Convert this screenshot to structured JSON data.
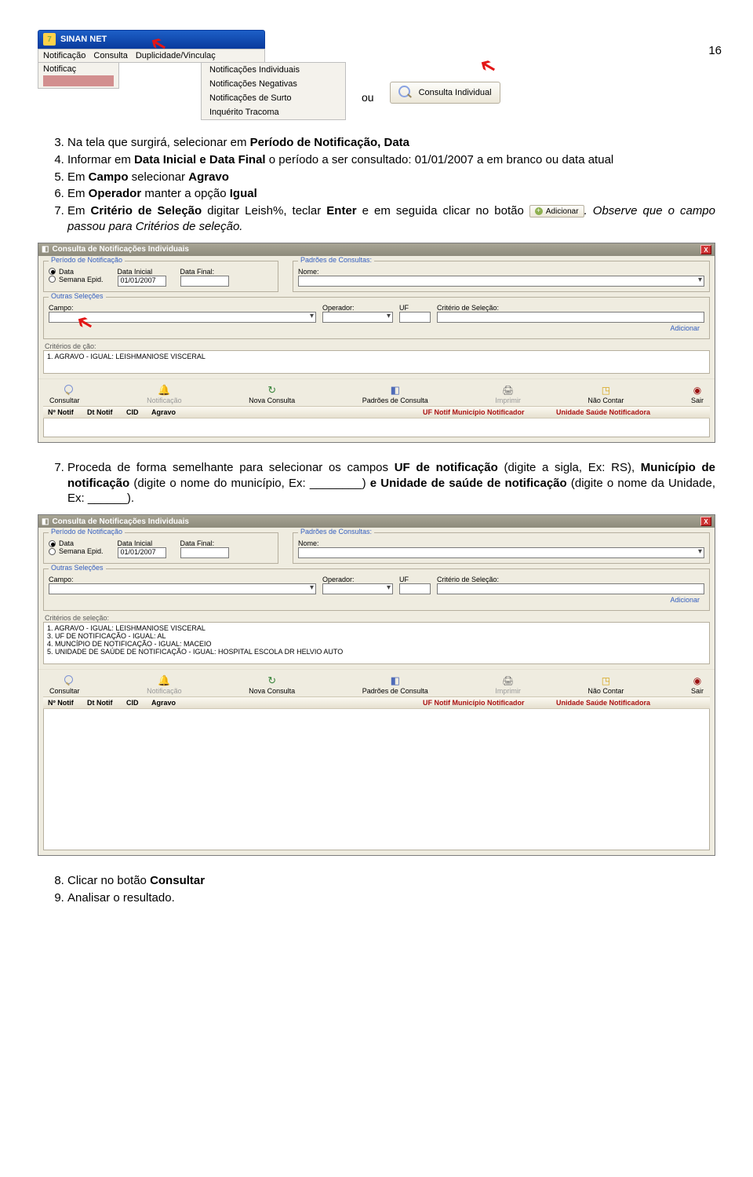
{
  "page_number": "16",
  "app_title": "SINAN NET",
  "menu": {
    "notif": "Notificação",
    "cons": "Consulta",
    "dup": "Duplicidade/Vinculaç"
  },
  "dropdown": {
    "i1": "Notificações Individuais",
    "i2": "Notificações Negativas",
    "i3": "Notificações de Surto",
    "i4": "Inquérito Tracoma"
  },
  "tab_label": "Notificaç",
  "ou_label": "ou",
  "lookup_btn": "Consulta Individual",
  "steps1": {
    "s3": "Na tela que surgirá, selecionar em ",
    "s3b": "Período de Notificação, Data",
    "s4a": "Informar em ",
    "s4b": "Data Inicial e Data Final",
    "s4c": " o período a ser consultado: 01/01/2007 a em branco ou data atual",
    "s5a": "Em ",
    "s5b": "Campo",
    "s5c": " selecionar ",
    "s5d": "Agravo",
    "s6a": "Em ",
    "s6b": "Operador ",
    "s6c": "manter a opção ",
    "s6d": "Igual",
    "s7a": "Em ",
    "s7b": "Critério de Seleção",
    "s7c": " digitar ",
    "s7d": "Leish%, ",
    "s7e": "teclar ",
    "s7f": "Enter",
    "s7g": " e em seguida clicar no botão ",
    "s7tail": ". Observe que o campo passou para Critérios de seleção."
  },
  "adicionar_btn": "Adicionar",
  "dialog": {
    "title": "Consulta de Notificações Individuais",
    "fs_periodo": "Período de Notificação",
    "fs_padroes": "Padrões de Consultas:",
    "nome": "Nome:",
    "radio_data": "Data",
    "radio_sem": "Semana Epid.",
    "lbl_di": "Data Inicial",
    "lbl_df": "Data Final:",
    "val_di": "01/01/2007",
    "fs_outras": "Outras Seleções",
    "lbl_campo": "Campo:",
    "lbl_oper": "Operador:",
    "lbl_uf": "UF",
    "lbl_crit": "Critério de Seleção:",
    "adicionar": "Adicionar",
    "crit_legend1": "Critérios de         ção:",
    "crit_line1": "1.  AGRAVO  -  IGUAL: LEISHMANIOSE VISCERAL",
    "t_cons": "Consultar",
    "t_notif": "Notificação",
    "t_nova": "Nova Consulta",
    "t_padr": "Padrões de Consulta",
    "t_impr": "Imprimir",
    "t_nc": "Não Contar",
    "t_sair": "Sair",
    "h1": "Nº Notif",
    "h2": "Dt Notif",
    "h3": "CID",
    "h4": "Agravo",
    "h5": "UF Notif Município Notificador",
    "h6": "Unidade Saúde Notificadora",
    "crit_legend2": "Critérios de seleção:",
    "crit2_1": "1.  AGRAVO  -  IGUAL: LEISHMANIOSE VISCERAL",
    "crit2_3": "3.  UF DE NOTIFICAÇÃO  -  IGUAL: AL",
    "crit2_4": "4.  MUNCÍPIO DE NOTIFICAÇÃO  -  IGUAL: MACEIO",
    "crit2_5": "5.  UNIDADE DE SAÚDE DE NOTIFICAÇÃO  -  IGUAL: HOSPITAL ESCOLA DR HELVIO AUTO"
  },
  "mid_para": {
    "a": "Proceda de forma semelhante para selecionar os campos ",
    "b": "UF de notificação",
    "c": " (digite a sigla, Ex: RS), ",
    "d": "Município de notificação",
    "e": " (digite o nome do município, Ex: ________) ",
    "f": "e ",
    "g": "Unidade de saúde de notificação",
    "h": " (digite o nome da Unidade, Ex: ______)."
  },
  "final": {
    "s8a": "Clicar no botão ",
    "s8b": "Consultar",
    "s9": "Analisar o resultado."
  }
}
